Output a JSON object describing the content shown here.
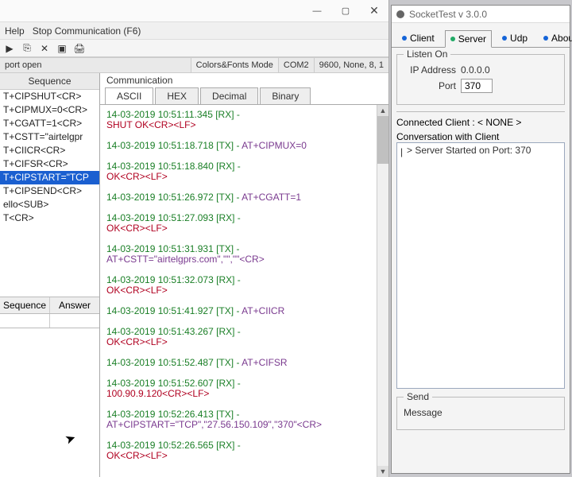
{
  "left": {
    "menu": {
      "help": "Help",
      "stop": "Stop Communication  (F6)"
    },
    "status": {
      "port": "port open",
      "colors": "Colors&Fonts Mode",
      "com": "COM2",
      "settings": "9600, None, 8, 1"
    },
    "sequence": {
      "header": "Sequence",
      "items": [
        "T+CIPSHUT<CR>",
        "T+CIPMUX=0<CR>",
        "T+CGATT=1<CR>",
        "T+CSTT=\"airtelgpr",
        "T+CIICR<CR>",
        "T+CIFSR<CR>",
        "T+CIPSTART=\"TCP",
        "T+CIPSEND<CR>",
        "ello<SUB>",
        "T<CR>"
      ],
      "selected_index": 6,
      "grid": {
        "col1": "Sequence",
        "col2": "Answer"
      }
    },
    "comm": {
      "label": "Communication",
      "tabs": {
        "ascii": "ASCII",
        "hex": "HEX",
        "dec": "Decimal",
        "bin": "Binary"
      },
      "lines": [
        {
          "h": "14-03-2019 10:51:11.345 [RX] - <CR><LF>",
          "b": "SHUT OK<CR><LF>",
          "bc": "l-red"
        },
        {
          "h": "14-03-2019 10:51:18.718 [TX] - AT+CIPMUX=0<CR>",
          "b": "",
          "bc": ""
        },
        {
          "h": "14-03-2019 10:51:18.840 [RX] - <CR><LF>",
          "b": "OK<CR><LF>",
          "bc": "l-red"
        },
        {
          "h": "14-03-2019 10:51:26.972 [TX] - AT+CGATT=1<CR>",
          "b": "",
          "bc": ""
        },
        {
          "h": "14-03-2019 10:51:27.093 [RX] - <CR><LF>",
          "b": "OK<CR><LF>",
          "bc": "l-red"
        },
        {
          "h": "14-03-2019 10:51:31.931 [TX] - ",
          "b": "AT+CSTT=\"airtelgprs.com\",\"\",\"\"<CR>",
          "bc": "l-purple"
        },
        {
          "h": "14-03-2019 10:51:32.073 [RX] - <CR><LF>",
          "b": "OK<CR><LF>",
          "bc": "l-red"
        },
        {
          "h": "14-03-2019 10:51:41.927 [TX] - AT+CIICR<CR>",
          "b": "",
          "bc": ""
        },
        {
          "h": "14-03-2019 10:51:43.267 [RX] - <CR><LF>",
          "b": "OK<CR><LF>",
          "bc": "l-red"
        },
        {
          "h": "14-03-2019 10:51:52.487 [TX] - AT+CIFSR<CR>",
          "b": "",
          "bc": ""
        },
        {
          "h": "14-03-2019 10:51:52.607 [RX] - <CR><LF>",
          "b": "100.90.9.120<CR><LF>",
          "bc": "l-red"
        },
        {
          "h": "14-03-2019 10:52:26.413 [TX] - ",
          "b": "AT+CIPSTART=\"TCP\",\"27.56.150.109\",\"370\"<CR>",
          "bc": "l-purple"
        },
        {
          "h": "14-03-2019 10:52:26.565 [RX] - <CR><LF>",
          "b": "OK<CR><LF>",
          "bc": "l-red"
        }
      ]
    }
  },
  "right": {
    "title": "SocketTest v 3.0.0",
    "tabs": {
      "client": "Client",
      "server": "Server",
      "udp": "Udp",
      "about": "About"
    },
    "listen": {
      "group": "Listen On",
      "ip_label": "IP Address",
      "ip": "0.0.0.0",
      "port_label": "Port",
      "port": "370"
    },
    "connected": {
      "label": "Connected Client : < NONE >",
      "conv_label": "Conversation with Client",
      "line": "> Server Started on Port: 370"
    },
    "send": {
      "group": "Send",
      "msg_label": "Message"
    }
  }
}
